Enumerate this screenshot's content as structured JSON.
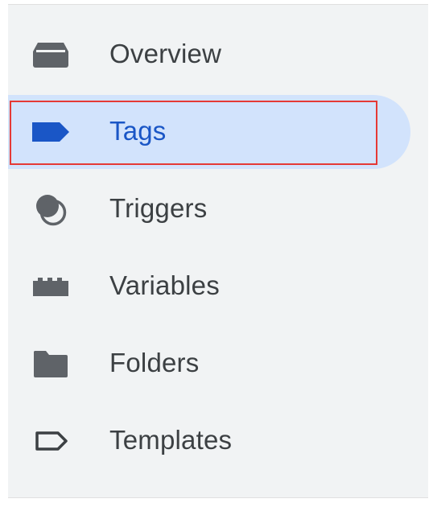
{
  "sidebar": {
    "items": [
      {
        "label": "Overview",
        "icon": "overview-icon",
        "active": false
      },
      {
        "label": "Tags",
        "icon": "tag-icon",
        "active": true
      },
      {
        "label": "Triggers",
        "icon": "triggers-icon",
        "active": false
      },
      {
        "label": "Variables",
        "icon": "variables-icon",
        "active": false
      },
      {
        "label": "Folders",
        "icon": "folder-icon",
        "active": false
      },
      {
        "label": "Templates",
        "icon": "templates-icon",
        "active": false
      }
    ]
  },
  "colors": {
    "panel_background": "#f1f3f4",
    "active_background": "#d2e3fc",
    "active_text": "#1a56c6",
    "text": "#3c4043",
    "icon": "#5f6368",
    "highlight_border": "#e53935"
  }
}
